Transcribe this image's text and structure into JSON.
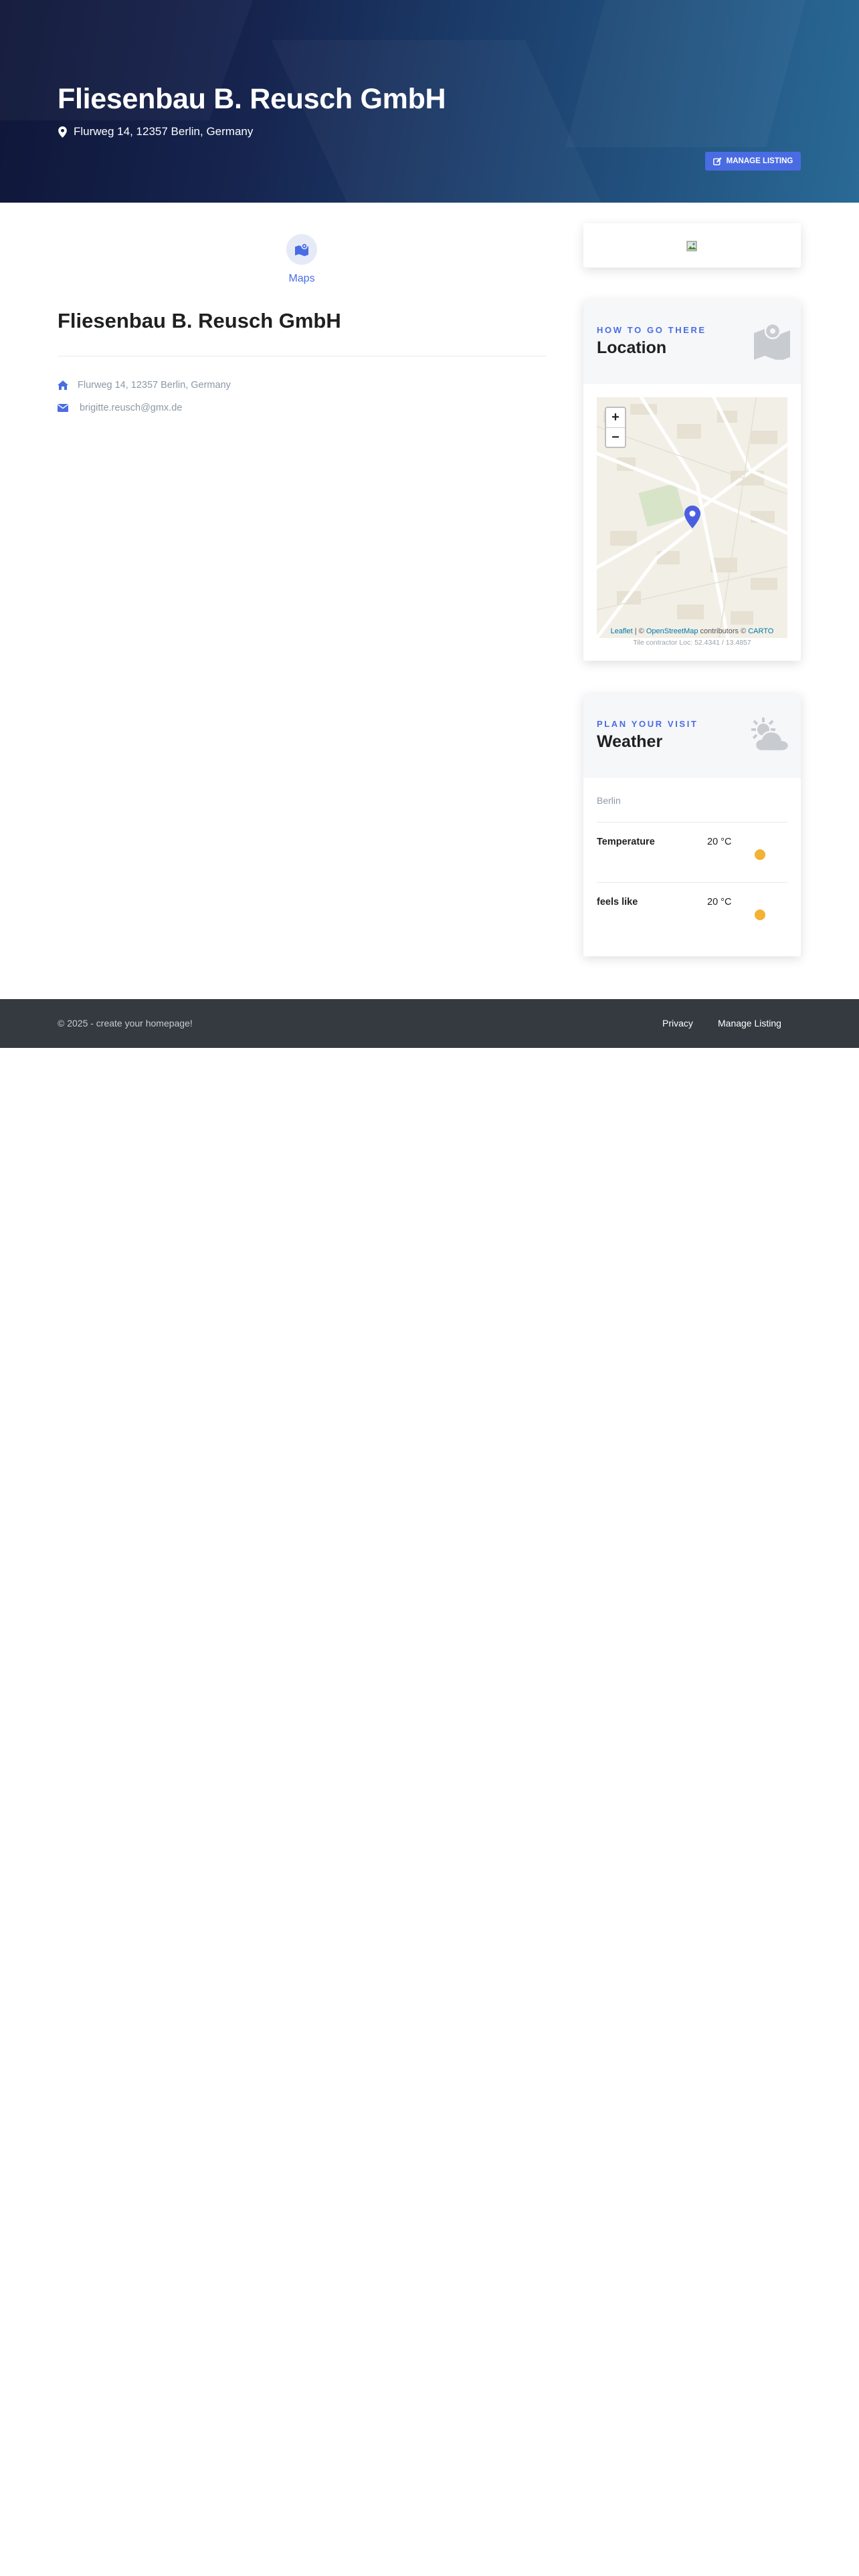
{
  "hero": {
    "title": "Fliesenbau B. Reusch GmbH",
    "address": "Flurweg 14, 12357 Berlin, Germany",
    "manage_label": "MANAGE LISTING",
    "gradient_from": "#0f1638",
    "gradient_to": "#2a6a96"
  },
  "main": {
    "category_label": "Maps",
    "title": "Fliesenbau B. Reusch GmbH",
    "address": "Flurweg 14, 12357 Berlin, Germany",
    "email": "brigitte.reusch@gmx.de"
  },
  "sidebar": {
    "image_card_icon": "broken-image-icon",
    "location": {
      "eyebrow": "HOW TO GO THERE",
      "title": "Location",
      "zoom_in": "+",
      "zoom_out": "−",
      "attribution_leaflet": "Leaflet",
      "attribution_sep": " | © ",
      "attribution_osm": "OpenStreetMap",
      "attribution_mid": " contributors © ",
      "attribution_carto": "CARTO",
      "tile_note": "Tile contractor Loc: 52.4341 / 13.4857"
    },
    "weather": {
      "eyebrow": "PLAN YOUR VISIT",
      "title": "Weather",
      "city": "Berlin",
      "rows": [
        {
          "label": "Temperature",
          "value": "20 °C"
        },
        {
          "label": "feels like",
          "value": "20 °C"
        }
      ]
    }
  },
  "footer": {
    "copyright": "© 2025 - create your homepage!",
    "privacy": "Privacy",
    "manage": "Manage Listing"
  },
  "colors": {
    "accent": "#4a6ce3",
    "dark": "#1e2022",
    "muted": "#8c98a4",
    "footer_bg": "#343a40"
  }
}
